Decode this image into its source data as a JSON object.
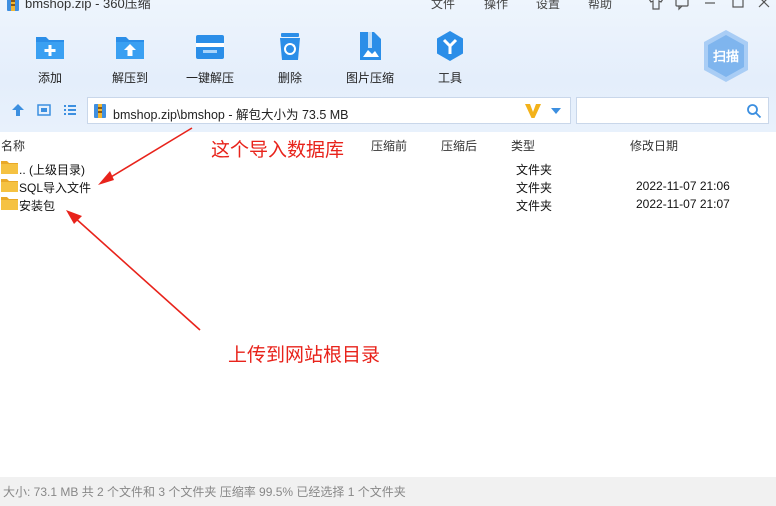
{
  "window": {
    "title": "bmshop.zip - 360压缩",
    "menu": [
      "文件",
      "操作",
      "设置",
      "帮助"
    ]
  },
  "toolbar": {
    "items": [
      {
        "label": "添加",
        "icon": "add-icon"
      },
      {
        "label": "解压到",
        "icon": "extract-to-icon"
      },
      {
        "label": "一键解压",
        "icon": "one-click-extract-icon"
      },
      {
        "label": "删除",
        "icon": "delete-icon"
      },
      {
        "label": "图片压缩",
        "icon": "image-compress-icon"
      },
      {
        "label": "工具",
        "icon": "tools-icon"
      }
    ],
    "scan_label": "扫描"
  },
  "address": {
    "path": "bmshop.zip\\bmshop - 解包大小为 73.5 MB",
    "search_placeholder": ""
  },
  "columns": [
    "名称",
    "压缩前",
    "压缩后",
    "类型",
    "修改日期"
  ],
  "rows": [
    {
      "name": ".. (上级目录)",
      "type": "文件夹",
      "modified": ""
    },
    {
      "name": "SQL导入文件",
      "type": "文件夹",
      "modified": "2022-11-07 21:06"
    },
    {
      "name": "安装包",
      "type": "文件夹",
      "modified": "2022-11-07 21:07"
    }
  ],
  "annotations": {
    "import_db": "这个导入数据库",
    "upload_root": "上传到网站根目录"
  },
  "status": {
    "text": "大小: 73.1 MB 共 2 个文件和 3 个文件夹 压缩率 99.5% 已经选择 1 个文件夹"
  },
  "colors": {
    "accent": "#2b8ee8",
    "annotation": "#e8231b",
    "toolbar_bg": "#e6f0fc",
    "folder": "#f5c242"
  }
}
